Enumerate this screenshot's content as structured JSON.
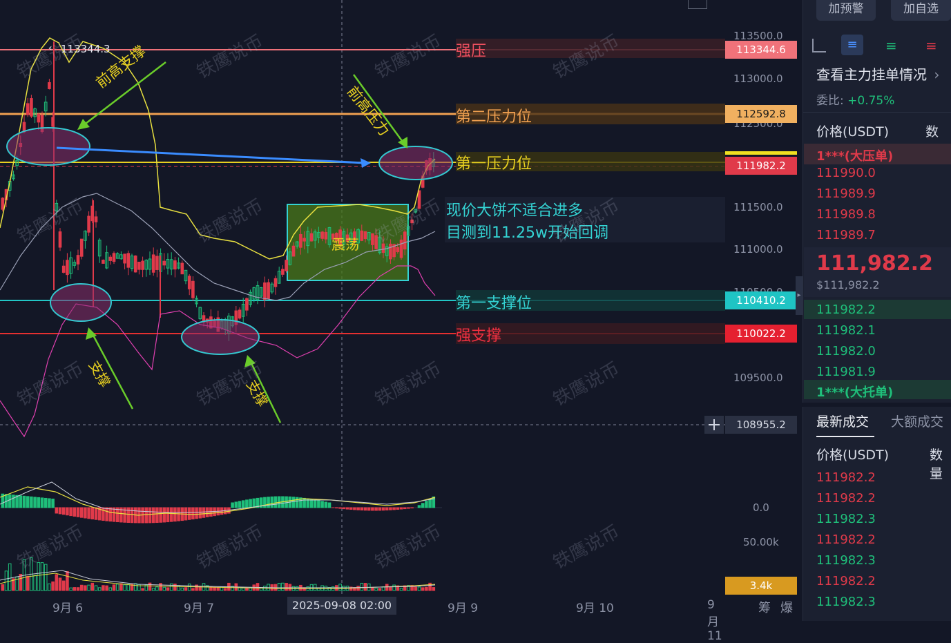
{
  "toolbar": {
    "alert_label": "加预警",
    "watchlist_label": "加自选"
  },
  "chart": {
    "peak_label": "113344.3",
    "annotations": {
      "prev_high_support": "前高支撑",
      "prev_high_resistance": "前高压力",
      "support_left": "支撑",
      "support_right": "支撑",
      "range_box": "震荡",
      "note_line1": "现价大饼不适合进多",
      "note_line2": "目测到11.25w开始回调"
    },
    "levels": {
      "strong_resistance": "强压",
      "second_resistance": "第二压力位",
      "first_resistance": "第一压力位",
      "first_support": "第一支撑位",
      "strong_support": "强支撑"
    },
    "watermark": "铁鹰说币"
  },
  "price_axis": {
    "ticks": [
      "113500.0",
      "113000.0",
      "112500.0",
      "111500.0",
      "111000.0",
      "110500.0",
      "109500.0",
      "0.0",
      "50.00k"
    ],
    "tags": {
      "strong_resistance": "113344.6",
      "second_resistance": "112592.8",
      "current": "111982.2",
      "first_support": "110410.2",
      "strong_support": "110022.2",
      "crosshair": "108955.2",
      "volume": "3.4k"
    }
  },
  "time_axis": {
    "labels": [
      "9月 6",
      "9月 7",
      "9月 9",
      "9月 10",
      "9月 11"
    ],
    "crosshair": "2025-09-08 02:00",
    "icons_text": [
      "筹",
      "爆"
    ]
  },
  "order_book": {
    "title": "查看主力挂单情况",
    "ratio_label": "委比:",
    "ratio_value": "+0.75%",
    "price_header": "价格(USDT)",
    "qty_header": "数量",
    "big_ask": "1***(大压单)",
    "asks": [
      "111990.0",
      "111989.9",
      "111989.8",
      "111989.7"
    ],
    "last_price": "111,982.2",
    "last_price_usd": "$111,982.2",
    "bids": [
      "111982.2",
      "111982.1",
      "111982.0",
      "111981.9"
    ],
    "big_bid": "1***(大托单)"
  },
  "trades": {
    "tab_latest": "最新成交",
    "tab_large": "大额成交",
    "price_header": "价格(USDT)",
    "qty_header": "数量",
    "rows": [
      {
        "price": "111982.2",
        "side": "sell"
      },
      {
        "price": "111982.2",
        "side": "sell"
      },
      {
        "price": "111982.3",
        "side": "buy"
      },
      {
        "price": "111982.2",
        "side": "sell"
      },
      {
        "price": "111982.3",
        "side": "buy"
      },
      {
        "price": "111982.2",
        "side": "sell"
      },
      {
        "price": "111982.3",
        "side": "buy"
      }
    ]
  }
}
